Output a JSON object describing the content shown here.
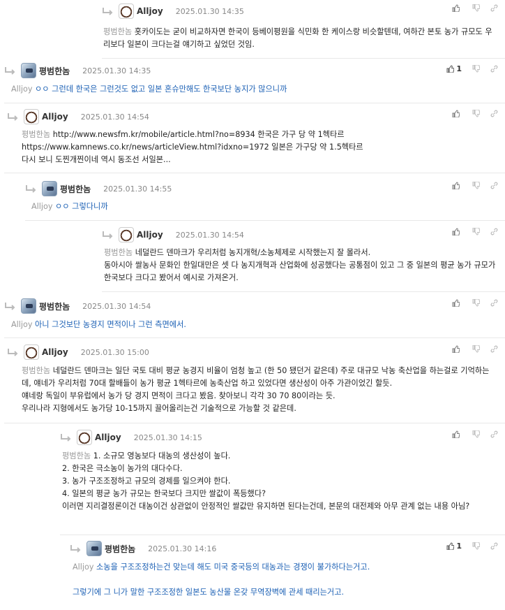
{
  "comments": [
    {
      "nick": "Alljoy",
      "date": "2025.01.30 14:35",
      "avatar": "dog",
      "like_count": "",
      "mention": "평범한놈",
      "text": "홋카이도는 굳이 비교하자면 한국이 등베이평원을 식민화 한 케이스랑 비슷할텐데, 여하간 본토 농가 규모도 우리보다 일본이 크다는걸 얘기하고 싶었던 것임.",
      "text_color": "dark"
    },
    {
      "nick": "평범한놈",
      "date": "2025.01.30 14:35",
      "avatar": "robot",
      "like_count": "1",
      "mention": "Alljoy",
      "text": "ㅇㅇ 그런데 한국은 그런것도 없고 일본 혼슈만해도 한국보단 농지가 많으니까",
      "text_color": "blue"
    },
    {
      "nick": "Alljoy",
      "date": "2025.01.30 14:54",
      "avatar": "dog",
      "like_count": "",
      "mention": "평범한놈",
      "text": "http://www.newsfm.kr/mobile/article.html?no=8934 한국은 가구 당 약 1헥타르\nhttps://www.kamnews.co.kr/news/articleView.html?idxno=1972 일본은 가구당 약 1.5헥타르\n다시 보니 도찐개찐이네 역시 동조선 서일본...",
      "text_color": "dark"
    },
    {
      "nick": "평범한놈",
      "date": "2025.01.30 14:55",
      "avatar": "robot",
      "like_count": "",
      "mention": "Alljoy",
      "text": "ㅇㅇ 그렇다니까",
      "text_color": "blue"
    },
    {
      "nick": "Alljoy",
      "date": "2025.01.30 14:54",
      "avatar": "dog",
      "like_count": "",
      "mention": "평범한놈",
      "text": "네덜란드 덴마크가 우리처럼 농지개혁/소농체제로 시작했는지 잘 몰라서.\n동아시아 쌀농사 문화인 한일대만은 셋 다 농지개혁과 산업화에 성공했다는 공통점이 있고 그 중 일본의 평균 농가 규모가 한국보다 크다고 봤어서 예시로 가져온거.",
      "text_color": "dark"
    },
    {
      "nick": "평범한놈",
      "date": "2025.01.30 14:54",
      "avatar": "robot",
      "like_count": "",
      "mention": "Alljoy",
      "text": "아니 그것보단 농경지 면적이나 그런 측면에서.",
      "text_color": "blue"
    },
    {
      "nick": "Alljoy",
      "date": "2025.01.30 15:00",
      "avatar": "dog",
      "like_count": "",
      "mention": "평범한놈",
      "text": "네덜란드 덴마크는 일단 국토 대비 평균 농경지 비율이 엄청 높고 (한 50 됐던거 같은데) 주로 대규모 낙농 축산업을 하는걸로 기억하는데, 얘네가 우리처럼 70대 할배들이 농가 평균 1헥타르에 농축산업 하고 있었다면 생산성이 아주 가관이었긴 할듯.\n얘네랑 독일이 부유럽에서 농가 당 경지 면적이 크다고 봤음. 찾아보니 각각 30 70 80이라는 듯.\n우리나라 지형에서도 농가당 10-15까지 끌어올리는건 기술적으로 가능할 것 같은데.",
      "text_color": "dark"
    },
    {
      "nick": "Alljoy",
      "date": "2025.01.30 14:15",
      "avatar": "dog",
      "like_count": "",
      "mention": "평범한놈",
      "text": "1. 소규모 영농보다 대농의 생산성이 높다.\n2. 한국은 극소농이 농가의 대다수다.\n3. 농가 구조조정하고 규모의 경제를 일으켜야 한다.\n4. 일본의 평균 농가 규모는 한국보다 크지만 쌀값이 폭등했다?\n이러면 지리결정론이건 대농이건 상관없이 안정적인 쌀값만 유지하면 된다는건데, 본문의 대전제와 아무 관계 없는 내용 아님?",
      "text_color": "dark"
    },
    {
      "nick": "평범한놈",
      "date": "2025.01.30 14:16",
      "avatar": "robot",
      "like_count": "1",
      "mention": "Alljoy",
      "text": "소농을 구조조정하는건 맞는데 해도 미국 중국등의 대농과는 경쟁이 불가하다는거고.\n\n그렇기에 그 니가 말한 구조조정한 일본도 농산물 온갖 무역장벽에 관세 때리는거고.",
      "text_color": "blue"
    }
  ],
  "icons": {
    "like": "thumbs-up-icon",
    "dislike": "thumbs-down-icon",
    "link": "link-icon",
    "reply": "reply-arrow-icon"
  }
}
